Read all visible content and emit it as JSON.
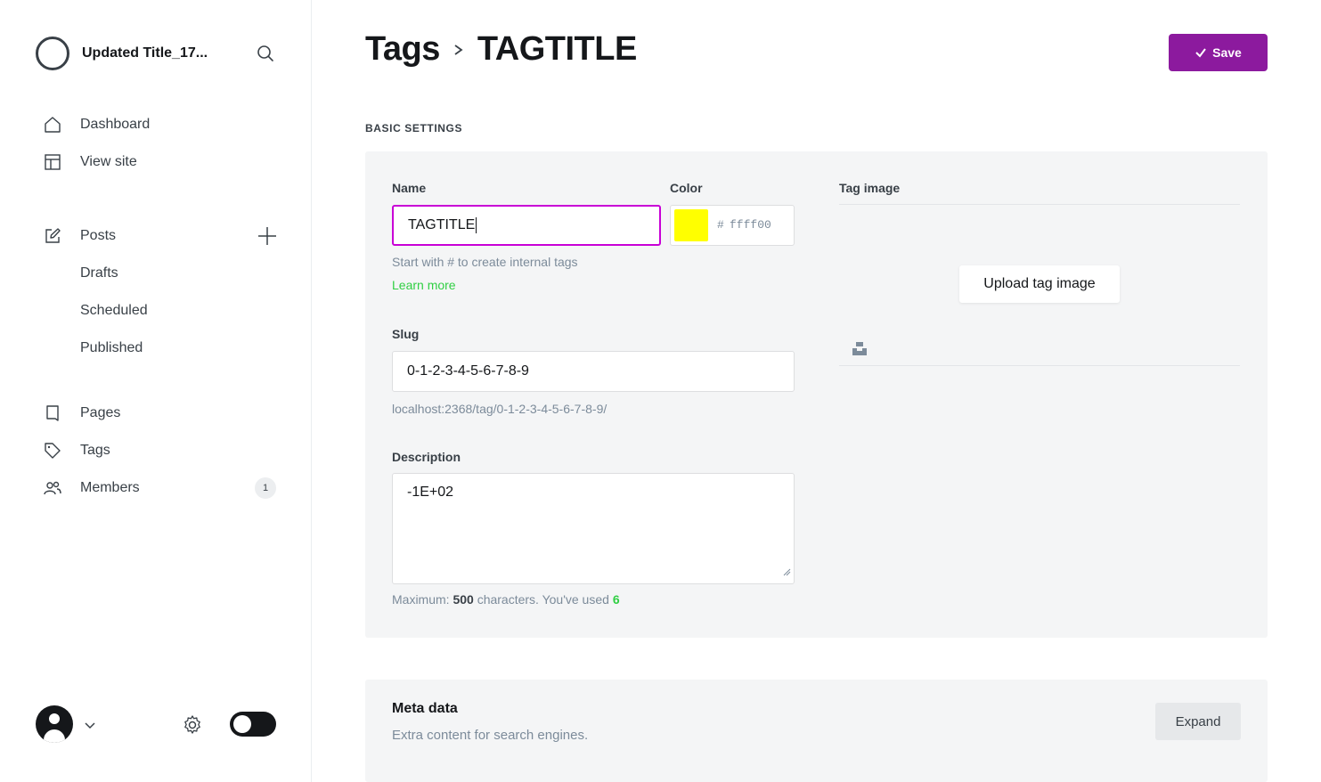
{
  "sidebar": {
    "site_title": "Updated Title_17...",
    "nav": [
      {
        "label": "Dashboard",
        "icon": "home-icon"
      },
      {
        "label": "View site",
        "icon": "view-site-icon"
      }
    ],
    "posts": {
      "label": "Posts",
      "icon": "edit-icon"
    },
    "post_filters": [
      "Drafts",
      "Scheduled",
      "Published"
    ],
    "nav2": [
      {
        "label": "Pages",
        "icon": "page-icon"
      },
      {
        "label": "Tags",
        "icon": "tag-icon"
      },
      {
        "label": "Members",
        "icon": "members-icon",
        "count": "1"
      }
    ]
  },
  "header": {
    "breadcrumb_parent": "Tags",
    "breadcrumb_current": "TAGTITLE",
    "save_label": "Save"
  },
  "basic_settings": {
    "section_title": "BASIC SETTINGS",
    "name": {
      "label": "Name",
      "value": "TAGTITLE",
      "hint": "Start with # to create internal tags",
      "learn_more": "Learn more"
    },
    "color": {
      "label": "Color",
      "hash": "#",
      "value": "ffff00",
      "swatch": "#ffff00"
    },
    "slug": {
      "label": "Slug",
      "value": "0-1-2-3-4-5-6-7-8-9",
      "url_hint": "localhost:2368/tag/0-1-2-3-4-5-6-7-8-9/"
    },
    "description": {
      "label": "Description",
      "value": "-1E+02",
      "count_prefix": "Maximum: ",
      "max": "500",
      "count_mid": " characters. You've used ",
      "used": "6"
    },
    "tag_image": {
      "label": "Tag image",
      "upload_label": "Upload tag image"
    }
  },
  "meta": {
    "title": "Meta data",
    "description": "Extra content for search engines.",
    "expand_label": "Expand"
  },
  "colors": {
    "accent": "#8c1a9e",
    "focus": "#c800d6",
    "green": "#30cf43"
  }
}
